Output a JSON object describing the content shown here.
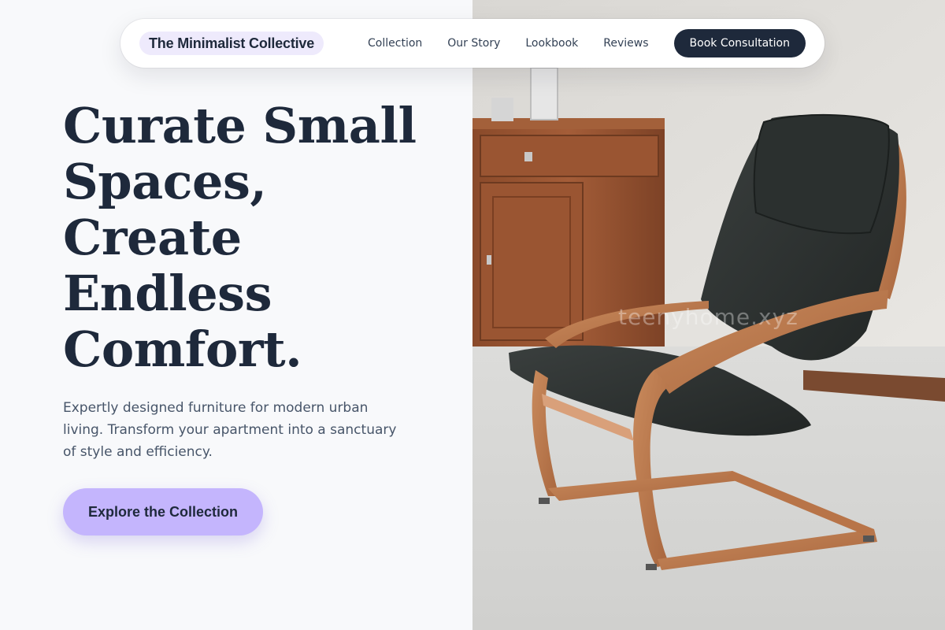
{
  "brand": {
    "name": "The Minimalist Collective"
  },
  "nav": {
    "links": [
      "Collection",
      "Our Story",
      "Lookbook",
      "Reviews"
    ],
    "cta_label": "Book Consultation"
  },
  "hero": {
    "headline_lines": [
      "Curate Small",
      "Spaces,",
      "Create",
      "Endless",
      "Comfort."
    ],
    "subtext": "Expertly designed furniture for modern urban living. Transform your apartment into a sanctuary of style and efficiency.",
    "cta_label": "Explore the Collection"
  },
  "image": {
    "watermark": "teenyhome.xyz",
    "subject": "bentwood-armchair-photo"
  },
  "colors": {
    "navy": "#1e293b",
    "lavender": "#c4b5fd",
    "brand_pill": "#eeeafc",
    "page_bg": "#f8f9fb"
  }
}
